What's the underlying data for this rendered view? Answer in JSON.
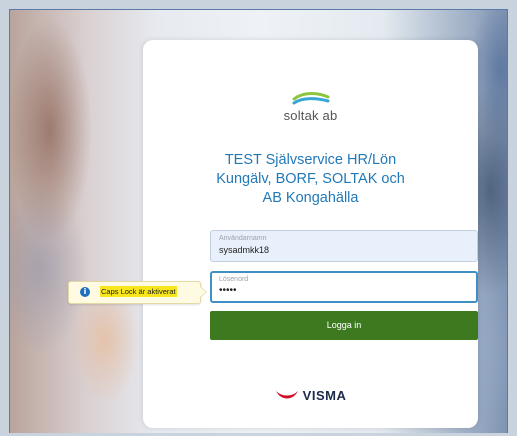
{
  "brand": {
    "logo_text": "soltak ab"
  },
  "title_lines": [
    "TEST Självservice HR/Lön",
    "Kungälv, BORF, SOLTAK och",
    "AB Kongahälla"
  ],
  "form": {
    "username": {
      "label": "Användarnamn",
      "value": "sysadmkk18"
    },
    "password": {
      "label": "Lösenord",
      "value": "•••••"
    },
    "submit_label": "Logga in"
  },
  "tooltip": {
    "icon": "info-icon",
    "text": "Caps Lock är aktiverat"
  },
  "footer": {
    "logo_text": "VISMA"
  },
  "colors": {
    "title": "#2279b8",
    "button": "#3d7a1f",
    "focus_border": "#3f8fc5",
    "tooltip_highlight": "#f7e61c",
    "visma_red": "#d0112b"
  }
}
